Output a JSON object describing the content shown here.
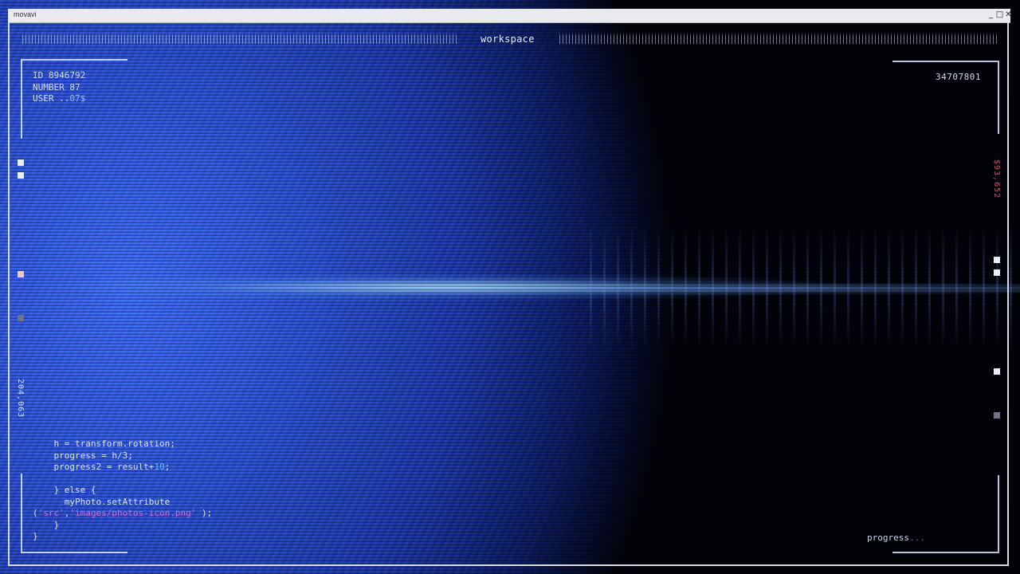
{
  "window": {
    "app_title": "movavi",
    "minimize_glyph": "_",
    "maximize_glyph": "□",
    "close_glyph": "✕"
  },
  "hud": {
    "workspace_label": "workspace",
    "info": {
      "id_line": "ID 8946792",
      "number_line": "NUMBER 87",
      "user_prefix": "USER ..",
      "user_suffix": "07$"
    },
    "top_right_id": "34707801",
    "left_vertical_readout": "204,063",
    "right_vertical_readout": "$93,652",
    "progress_label": "progress",
    "progress_ellipsis": "..."
  },
  "code": {
    "line1": "h = transform.rotation;",
    "line2": "progress = h/3;",
    "line3_prefix": "progress2 = result+",
    "line3_number": "10",
    "line3_suffix": ";",
    "line4": "} else {",
    "line5": "myPhoto.setAttribute",
    "line6_open": "(",
    "line6_str1": "'src'",
    "line6_sep": ",",
    "line6_str2": "'images/photos-icon.png'",
    "line6_close": ");",
    "line7": "}",
    "line8": "}"
  },
  "colors": {
    "accent_blue": "#3f6cff",
    "code_number": "#69c7ff",
    "code_string": "#d86ad0",
    "readout_red": "#d4506a"
  }
}
